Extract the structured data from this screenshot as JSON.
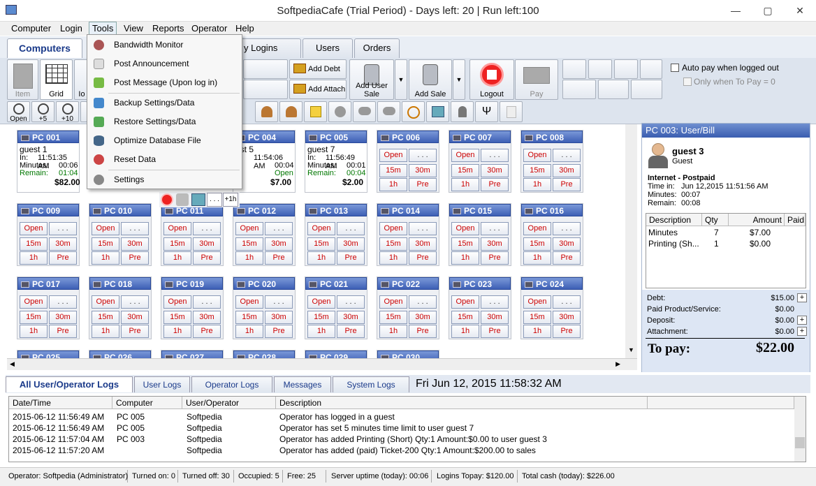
{
  "window": {
    "title": "SoftpediaCafe (Trial Period) - Days left: 20 | Run left:100",
    "min": "—",
    "max": "▢",
    "close": "✕"
  },
  "menu": [
    "Computer",
    "Login",
    "Tools",
    "View",
    "Reports",
    "Operator",
    "Help"
  ],
  "tabs": [
    "Computers",
    "y Logins",
    "Users",
    "Orders"
  ],
  "toolbar": {
    "item": "Item",
    "grid": "Grid",
    "icons": "Io",
    "add_debt": "Add Debt",
    "add_attach": "Add Attach",
    "add_user_sale": "Add User Sale",
    "add_sale": "Add Sale",
    "logout": "Logout",
    "pay": "Pay",
    "auto_pay": "Auto pay when logged out",
    "only_when": "Only when To Pay = 0",
    "open": "Open",
    "plus5": "+5",
    "plus10": "+10"
  },
  "tools_menu": [
    "Bandwidth Monitor",
    "Post Announcement",
    "Post Message (Upon log in)",
    "Backup Settings/Data",
    "Restore Settings/Data",
    "Optimize Database File",
    "Reset Data",
    "Settings"
  ],
  "pc_buttons": {
    "open": "Open",
    "dots": ". . .",
    "m15": "15m",
    "m30": "30m",
    "h1": "1h",
    "pre": "Pre"
  },
  "pcs": [
    "PC 001",
    "PC 004",
    "PC 005",
    "PC 006",
    "PC 007",
    "PC 008",
    "PC 009",
    "PC 010",
    "PC 011",
    "PC 012",
    "PC 013",
    "PC 014",
    "PC 015",
    "PC 016",
    "PC 017",
    "PC 018",
    "PC 019",
    "PC 020",
    "PC 021",
    "PC 022",
    "PC 023",
    "PC 024",
    "PC 025",
    "PC 026",
    "PC 027",
    "PC 028",
    "PC 029",
    "PC 030"
  ],
  "active": {
    "pc001": {
      "user": "guest 1",
      "in": "In:",
      "in_v": "11:51:35 AM",
      "min": "Minutes:",
      "min_v": "00:06",
      "rem": "Remain:",
      "rem_v": "01:04",
      "amt": "$82.00"
    },
    "pc004": {
      "user": "est 5",
      "in_v": "11:54:06 AM",
      "min_v": "00:04",
      "rem_v": "Open",
      "amt": "$7.00"
    },
    "pc005": {
      "user": "guest 7",
      "in": "In:",
      "in_v": "11:56:49 AM",
      "min": "Minutes:",
      "min_v": "00:01",
      "rem": "Remain:",
      "rem_v": "00:04",
      "amt": "$2.00"
    }
  },
  "popup": {
    "dots": ". . .",
    "h1": "+1h"
  },
  "panel": {
    "header": "PC 003: User/Bill",
    "user": "guest 3",
    "role": "Guest",
    "type": "Internet - Postpaid",
    "time_in_l": "Time in:",
    "time_in": "Jun 12,2015 11:51:56 AM",
    "minutes_l": "Minutes:",
    "minutes": "00:07",
    "remain_l": "Remain:",
    "remain": "00:08",
    "cols": [
      "Description",
      "Qty",
      "Amount",
      "Paid"
    ],
    "rows": [
      {
        "d": "Minutes",
        "q": "7",
        "a": "$7.00"
      },
      {
        "d": "Printing (Sh...",
        "q": "1",
        "a": "$0.00"
      }
    ],
    "debt_l": "Debt:",
    "debt": "$15.00",
    "paid_l": "Paid Product/Service:",
    "paid": "$0.00",
    "deposit_l": "Deposit:",
    "deposit": "$0.00",
    "attach_l": "Attachment:",
    "attach": "$0.00",
    "topay_l": "To pay:",
    "topay": "$22.00",
    "plus": "+"
  },
  "logtabs": [
    "All User/Operator Logs",
    "User Logs",
    "Operator Logs",
    "Messages",
    "System Logs"
  ],
  "datetime": "Fri Jun 12, 2015  11:58:32 AM",
  "logcols": [
    "Date/Time",
    "Computer",
    "User/Operator",
    "Description"
  ],
  "logs": [
    {
      "t": "2015-06-12 11:56:49 AM",
      "c": "PC 005",
      "u": "Softpedia",
      "d": "Operator has logged in a guest"
    },
    {
      "t": "2015-06-12 11:56:49 AM",
      "c": "PC 005",
      "u": "Softpedia",
      "d": "Operator has set 5 minutes time limit to user guest 7"
    },
    {
      "t": "2015-06-12 11:57:04 AM",
      "c": "PC 003",
      "u": "Softpedia",
      "d": "Operator has added Printing (Short) Qty:1 Amount:$0.00 to user guest 3"
    },
    {
      "t": "2015-06-12 11:57:20 AM",
      "c": "",
      "u": "Softpedia",
      "d": "Operator has added (paid) Ticket-200 Qty:1 Amount:$200.00 to sales"
    }
  ],
  "status": [
    "Operator: Softpedia (Administrator)",
    "Turned on: 0",
    "Turned off: 30",
    "Occupied: 5",
    "Free: 25",
    "Server uptime (today): 00:06",
    "Logins Topay: $120.00",
    "Total cash (today): $226.00"
  ]
}
